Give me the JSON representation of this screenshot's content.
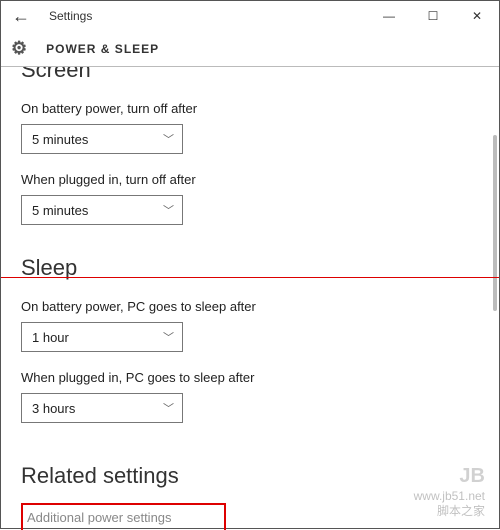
{
  "window": {
    "title": "Settings"
  },
  "header": {
    "title": "POWER & SLEEP"
  },
  "sections": {
    "screen": {
      "heading": "Screen",
      "battery_label": "On battery power, turn off after",
      "battery_value": "5 minutes",
      "plugged_label": "When plugged in, turn off after",
      "plugged_value": "5 minutes"
    },
    "sleep": {
      "heading": "Sleep",
      "battery_label": "On battery power, PC goes to sleep after",
      "battery_value": "1 hour",
      "plugged_label": "When plugged in, PC goes to sleep after",
      "plugged_value": "3 hours"
    },
    "related": {
      "heading": "Related settings",
      "link": "Additional power settings"
    }
  },
  "watermark": {
    "brand": "JB",
    "site": "www.jb51.net",
    "name": "脚本之家"
  }
}
